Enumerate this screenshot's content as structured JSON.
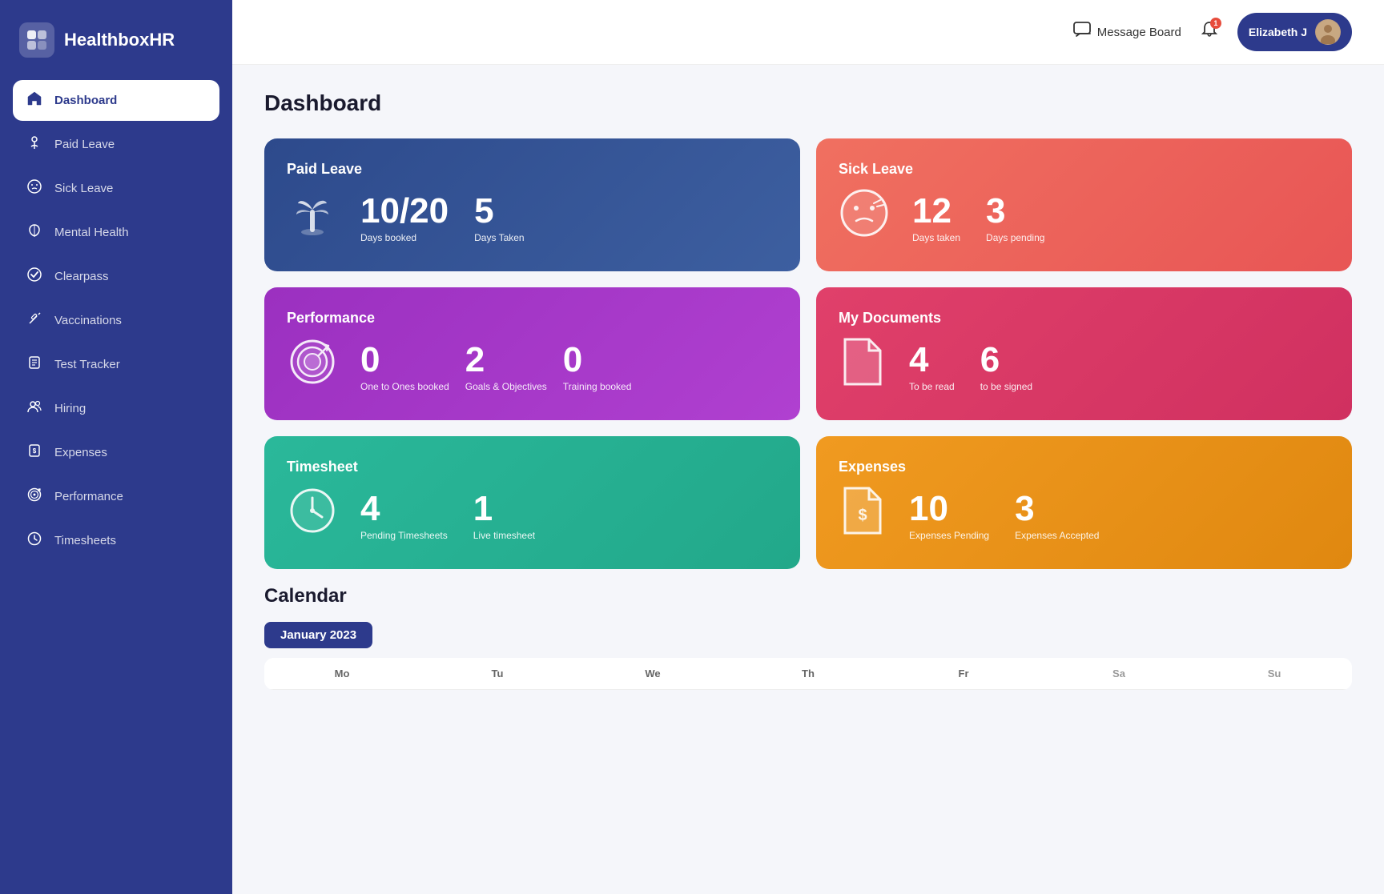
{
  "app": {
    "name": "HealthboxHR"
  },
  "header": {
    "message_board": "Message Board",
    "user_name": "Elizabeth J",
    "notification_count": "1"
  },
  "sidebar": {
    "items": [
      {
        "id": "dashboard",
        "label": "Dashboard",
        "icon": "🏠",
        "active": true
      },
      {
        "id": "paid-leave",
        "label": "Paid Leave",
        "icon": "⛱"
      },
      {
        "id": "sick-leave",
        "label": "Sick Leave",
        "icon": "😷"
      },
      {
        "id": "mental-health",
        "label": "Mental Health",
        "icon": "🧠"
      },
      {
        "id": "clearpass",
        "label": "Clearpass",
        "icon": "✅"
      },
      {
        "id": "vaccinations",
        "label": "Vaccinations",
        "icon": "💉"
      },
      {
        "id": "test-tracker",
        "label": "Test Tracker",
        "icon": "📋"
      },
      {
        "id": "hiring",
        "label": "Hiring",
        "icon": "👥"
      },
      {
        "id": "expenses",
        "label": "Expenses",
        "icon": "💲"
      },
      {
        "id": "performance",
        "label": "Performance",
        "icon": "🎯"
      },
      {
        "id": "timesheets",
        "label": "Timesheets",
        "icon": "⏱"
      }
    ]
  },
  "page": {
    "title": "Dashboard"
  },
  "cards": {
    "paid_leave": {
      "title": "Paid Leave",
      "stat1_value": "10/20",
      "stat1_label": "Days booked",
      "stat2_value": "5",
      "stat2_label": "Days Taken"
    },
    "sick_leave": {
      "title": "Sick Leave",
      "stat1_value": "12",
      "stat1_label": "Days taken",
      "stat2_value": "3",
      "stat2_label": "Days pending"
    },
    "performance": {
      "title": "Performance",
      "stat1_value": "0",
      "stat1_label": "One to Ones booked",
      "stat2_value": "2",
      "stat2_label": "Goals & Objectives",
      "stat3_value": "0",
      "stat3_label": "Training booked"
    },
    "documents": {
      "title": "My Documents",
      "stat1_value": "4",
      "stat1_label": "To be read",
      "stat2_value": "6",
      "stat2_label": "to be signed"
    },
    "timesheet": {
      "title": "Timesheet",
      "stat1_value": "4",
      "stat1_label": "Pending Timesheets",
      "stat2_value": "1",
      "stat2_label": "Live timesheet"
    },
    "expenses": {
      "title": "Expenses",
      "stat1_value": "10",
      "stat1_label": "Expenses Pending",
      "stat2_value": "3",
      "stat2_label": "Expenses Accepted"
    }
  },
  "calendar": {
    "title": "Calendar",
    "month": "January 2023",
    "day_headers": [
      "Mo",
      "Tu",
      "We",
      "Th",
      "Fr",
      "Sa",
      "Su"
    ]
  }
}
